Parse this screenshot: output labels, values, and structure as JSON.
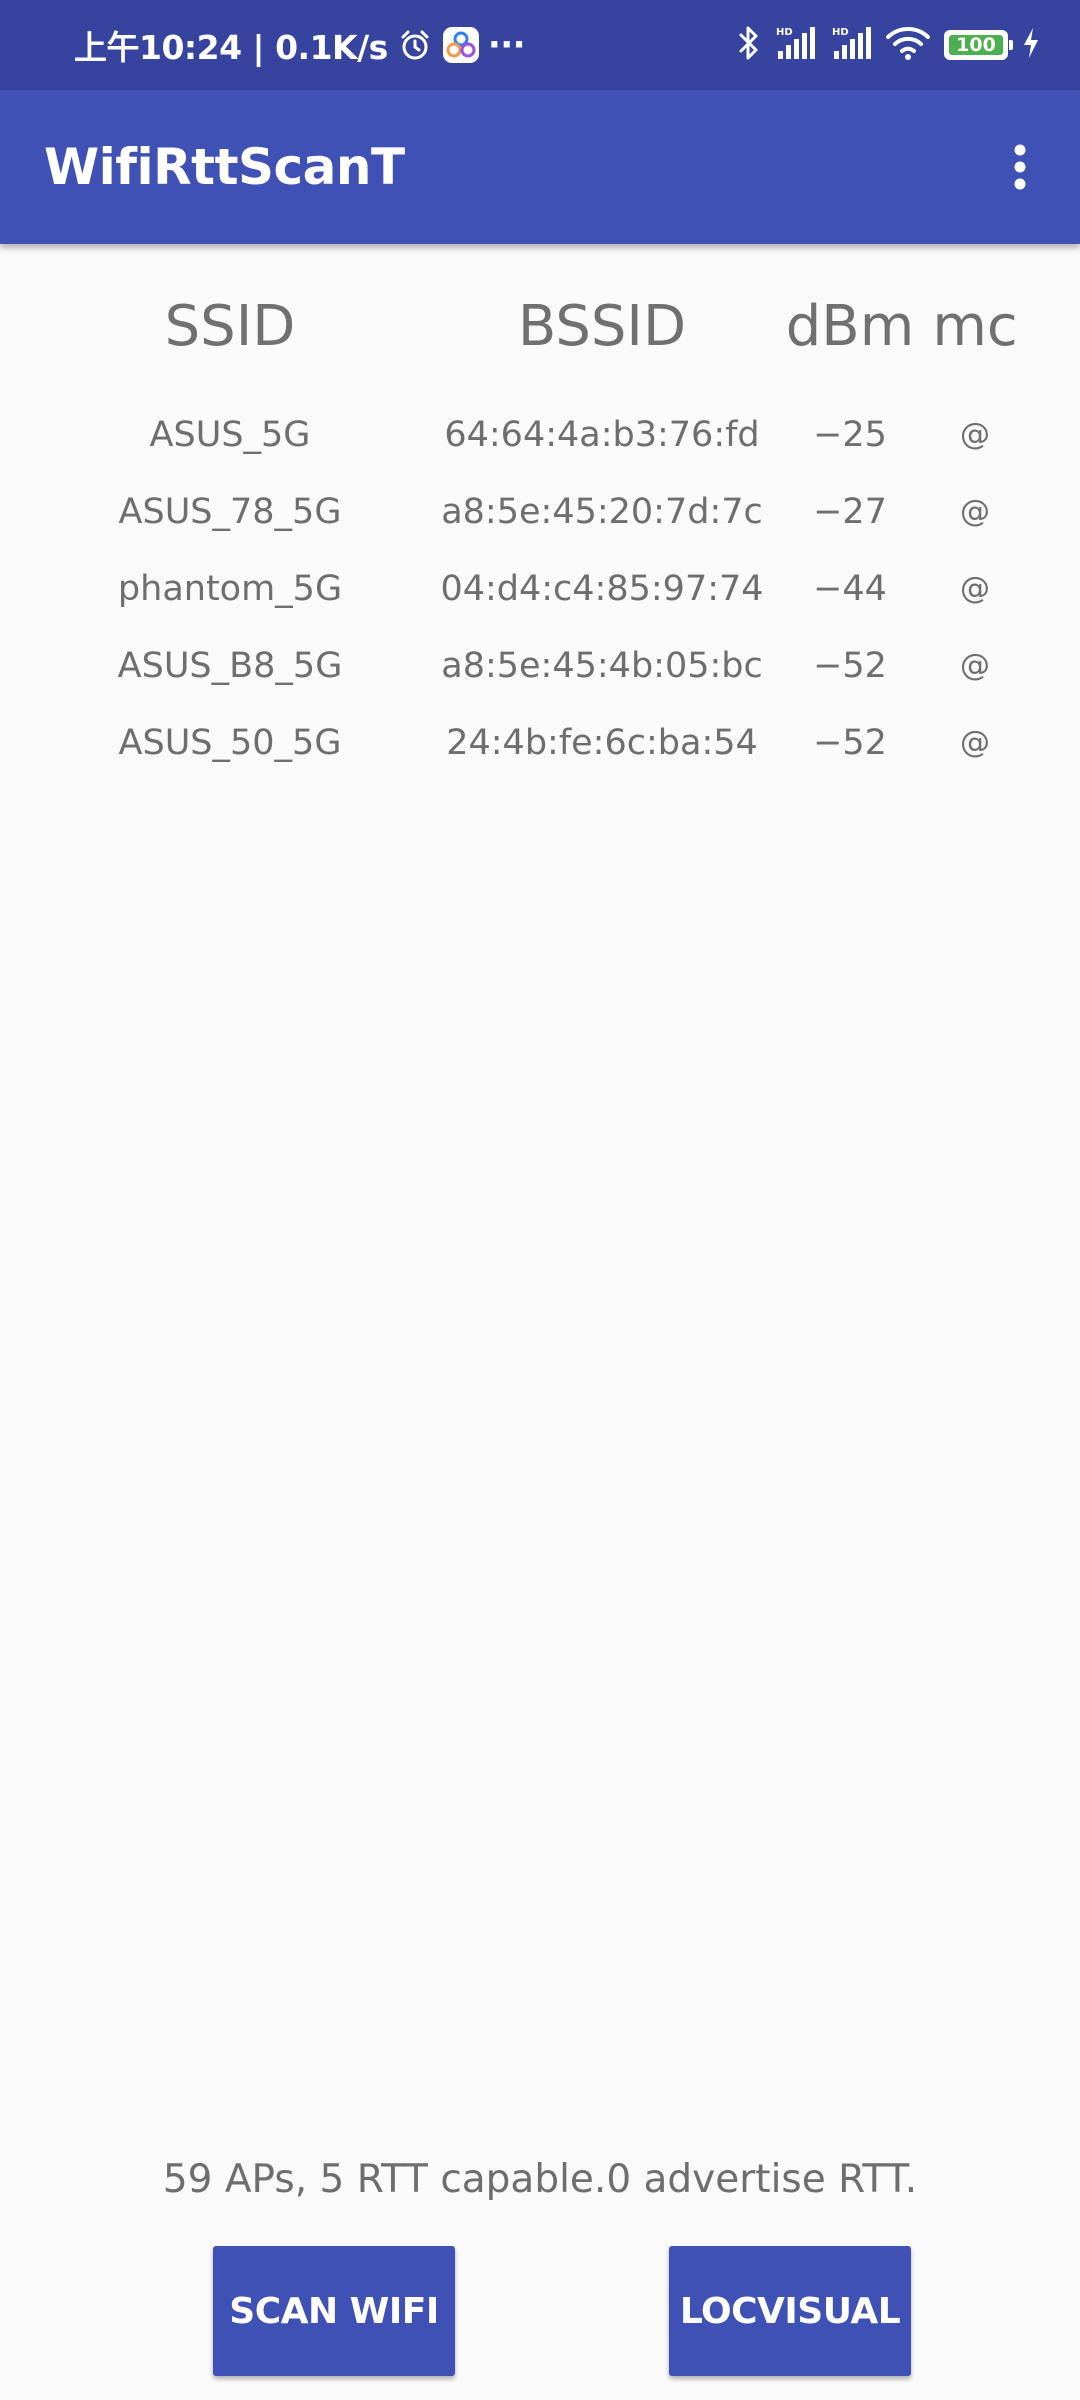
{
  "status_bar": {
    "time_text": "上午10:24 | 0.1K/s",
    "more_text": "···",
    "battery_level": "100",
    "background_color": "#3644a0",
    "icons": [
      "alarm-clock-icon",
      "app-notification-icon",
      "bluetooth-icon",
      "signal-hd-icon",
      "signal-hd-icon",
      "wifi-icon",
      "battery-icon",
      "charging-bolt-icon"
    ]
  },
  "app_bar": {
    "title": "WifiRttScanT",
    "background_color": "#3f51b5",
    "menu_icon": "more-vert-icon"
  },
  "table": {
    "headers": {
      "ssid": "SSID",
      "bssid": "BSSID",
      "dbm": "dBm",
      "mc": "mc"
    },
    "rows": [
      {
        "ssid": "ASUS_5G",
        "bssid": "64:64:4a:b3:76:fd",
        "dbm": "−25",
        "mc": "@"
      },
      {
        "ssid": "ASUS_78_5G",
        "bssid": "a8:5e:45:20:7d:7c",
        "dbm": "−27",
        "mc": "@"
      },
      {
        "ssid": "phantom_5G",
        "bssid": "04:d4:c4:85:97:74",
        "dbm": "−44",
        "mc": "@"
      },
      {
        "ssid": "ASUS_B8_5G",
        "bssid": "a8:5e:45:4b:05:bc",
        "dbm": "−52",
        "mc": "@"
      },
      {
        "ssid": "ASUS_50_5G",
        "bssid": "24:4b:fe:6c:ba:54",
        "dbm": "−52",
        "mc": "@"
      }
    ]
  },
  "summary": "59 APs, 5 RTT capable.0 advertise RTT.",
  "buttons": {
    "scan_label": "SCAN WIFI",
    "locvisual_label": "LOCVISUAL"
  }
}
